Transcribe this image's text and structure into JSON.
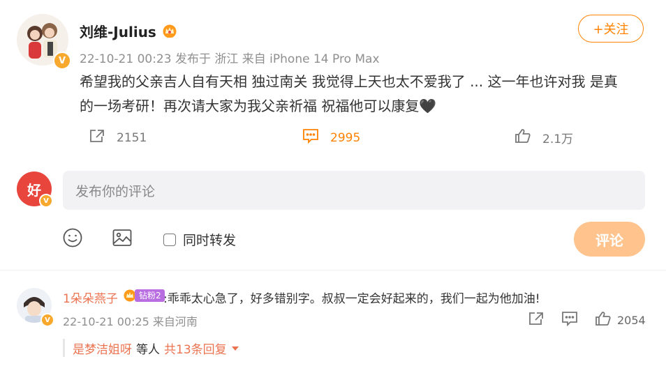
{
  "post": {
    "author": "刘维-Julius",
    "meta": "22-10-21 00:23  发布于 浙江  来自 iPhone 14 Pro Max",
    "follow_label": "+关注",
    "text_line1": "希望我的父亲吉人自有天相 独过南关 我觉得上天也太不爱我了 ... 这一年也许对我 是真",
    "text_line2": "的一场考研！再次请大家为我父亲祈福 祝福他可以康复🖤",
    "repost_count": "2151",
    "comment_count": "2995",
    "like_count": "2.1万"
  },
  "composer": {
    "placeholder": "发布你的评论",
    "repost_label": "同时转发",
    "submit_label": "评论",
    "avatar_text": "好"
  },
  "comment": {
    "user": "1朵朵燕子",
    "badge": "钻粉2",
    "text": ":乖乖太心急了，好多错别字。叔叔一定会好起来的，我们一起为他加油!",
    "meta": "22-10-21 00:25  来自河南",
    "like_count": "2054"
  },
  "replies": {
    "user": "是梦洁姐呀",
    "etc": "等人",
    "total": "共13条回复"
  },
  "colors": {
    "accent": "#ff8200",
    "username": "#eb7350",
    "verified": "#f7a82d",
    "submit_disabled": "#ffc48d"
  },
  "icons": [
    "verified-icon",
    "crown-icon",
    "repost-icon",
    "comment-icon",
    "like-icon",
    "emoji-icon",
    "image-icon",
    "caret-down-icon"
  ]
}
